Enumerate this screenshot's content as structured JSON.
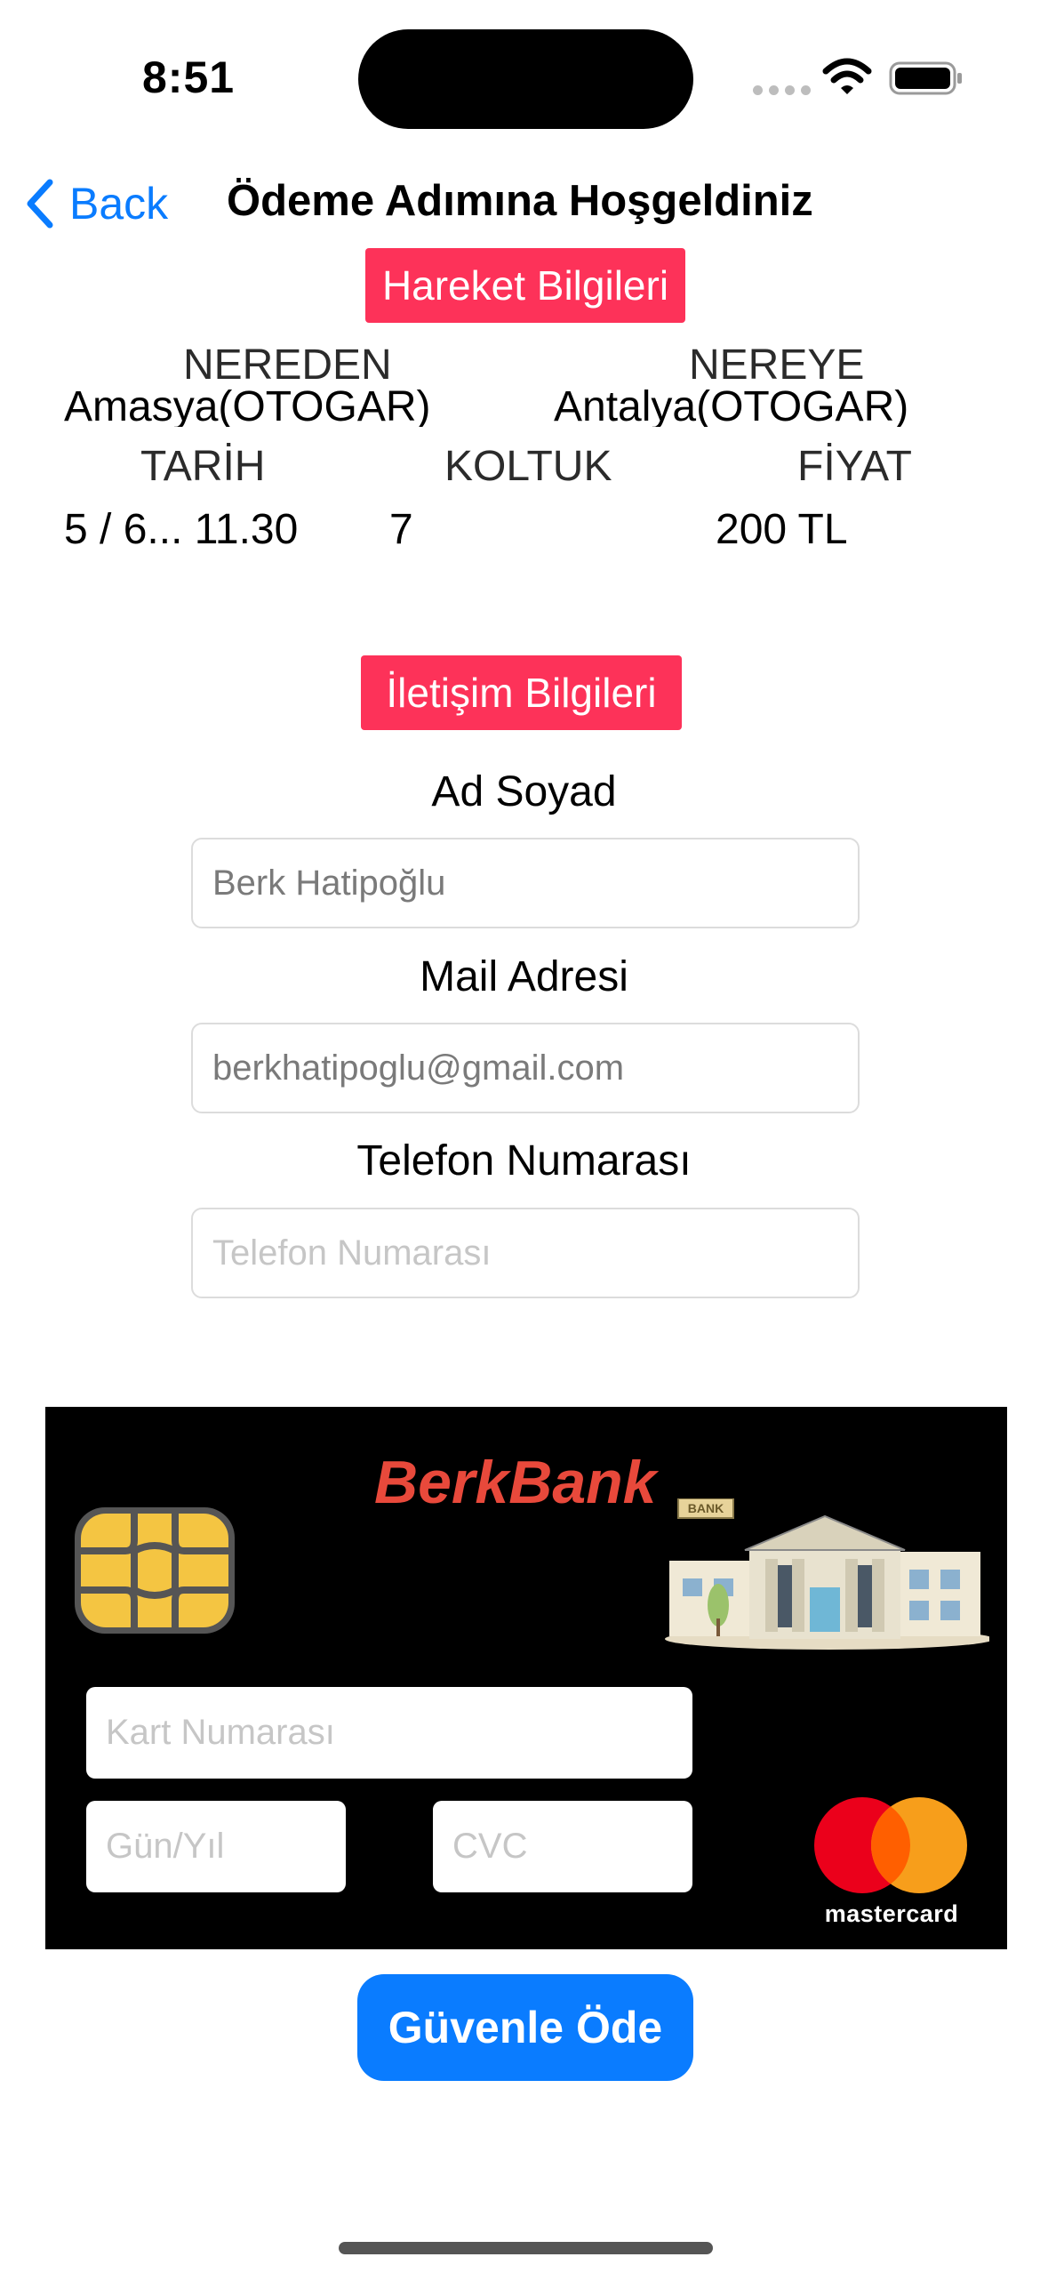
{
  "status_bar": {
    "time": "8:51"
  },
  "nav": {
    "back_label": "Back",
    "title": "Ödeme Adımına Hoşgeldiniz"
  },
  "trip": {
    "section_label": "Hareket Bilgileri",
    "from_label": "NEREDEN",
    "from_value": "Amasya(OTOGAR)",
    "to_label": "NEREYE",
    "to_value": "Antalya(OTOGAR)",
    "date_label": "TARİH",
    "date_value": "5 / 6... 11.30",
    "seat_label": "KOLTUK",
    "seat_value": "7",
    "price_label": "FİYAT",
    "price_value": "200 TL"
  },
  "contact": {
    "section_label": "İletişim Bilgileri",
    "name_label": "Ad Soyad",
    "name_value": "Berk Hatipoğlu",
    "mail_label": "Mail Adresi",
    "mail_value": "berkhatipoglu@gmail.com",
    "phone_label": "Telefon Numarası",
    "phone_placeholder": "Telefon Numarası"
  },
  "card": {
    "bank_name": "BerkBank",
    "building_sign": "BANK",
    "number_placeholder": "Kart Numarası",
    "date_placeholder": "Gün/Yıl",
    "cvc_placeholder": "CVC",
    "brand_label": "mastercard",
    "colors": {
      "background": "#000000",
      "bank_name": "#e8493b",
      "mc_red": "#eb001b",
      "mc_orange": "#f79e1b"
    }
  },
  "actions": {
    "pay_label": "Güvenle Öde"
  },
  "colors": {
    "accent": "#0a7cff",
    "section_pill": "#fd3259"
  },
  "icons": {
    "back": "chevron-left-icon",
    "wifi": "wifi-icon",
    "battery": "battery-icon",
    "chip": "card-chip-icon",
    "building": "bank-building-icon",
    "brand": "mastercard-logo"
  }
}
